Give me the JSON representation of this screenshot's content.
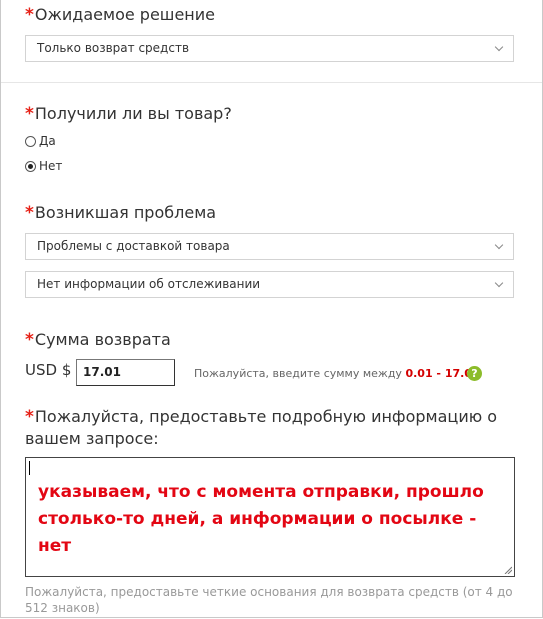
{
  "expected_solution": {
    "star": "*",
    "label": "Ожидаемое решение",
    "selected": "Только возврат средств"
  },
  "received_item": {
    "star": "*",
    "label": "Получили ли вы товар?",
    "options": [
      "Да",
      "Нет"
    ],
    "selected": "Нет"
  },
  "problem": {
    "star": "*",
    "label": "Возникшая проблема",
    "selected_primary": "Проблемы с доставкой товара",
    "selected_secondary": "Нет информации об отслеживании"
  },
  "refund_amount": {
    "star": "*",
    "label": "Сумма возврата",
    "currency": "USD $",
    "value": "17.01",
    "hint_prefix": "Пожалуйста, введите сумму между ",
    "hint_range": "0.01 - 17.01",
    "help_glyph": "?"
  },
  "details": {
    "star": "*",
    "label": "Пожалуйста, предоставьте подробную информацию о вашем запросе:",
    "annotation": "указываем, что с момента отправки, прошло столько-то дней, а информации о посылке - нет",
    "footer_hint": "Пожалуйста, предоставьте четкие основания для возврата средств (от 4 до 512 знаков)"
  },
  "colors": {
    "required_star": "#e62117",
    "range_text": "#d40000",
    "help_icon": "#8cbc2a",
    "annotation_text": "#e30613"
  },
  "icons": {
    "select_arrow": "chevron-down-icon",
    "help": "question-icon",
    "resize": "resize-grip-icon"
  }
}
